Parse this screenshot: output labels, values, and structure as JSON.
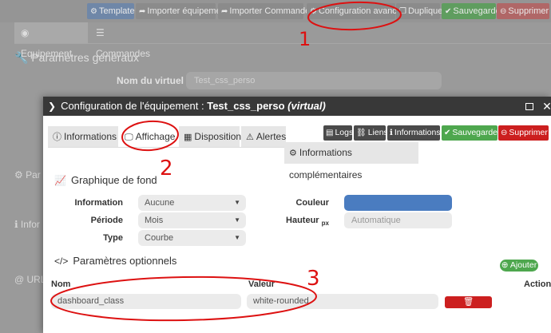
{
  "topbar": {
    "template": "Template",
    "import_equipment": "Importer équipement",
    "import_commands": "Importer Commandes",
    "advanced_config": "Configuration avancée",
    "duplicate": "Dupliquer",
    "save": "Sauvegarder",
    "delete": "Supprimer"
  },
  "bg_tabs": {
    "equipment": "Equipement",
    "commands": "Commandes"
  },
  "bg_page": {
    "general_params": "Paramètres généraux",
    "virtual_name_label": "Nom du virtuel",
    "virtual_name_value": "Test_css_perso",
    "side_partial_1": "Par",
    "side_partial_2": "Infor",
    "side_partial_3": "URL"
  },
  "modal": {
    "title_prefix": "Configuration de l'équipement : ",
    "title_name": "Test_css_perso",
    "title_suffix": "(virtual)",
    "tabs": {
      "informations": "Informations",
      "affichage": "Affichage",
      "disposition": "Disposition",
      "alertes": "Alertes"
    },
    "actions": {
      "logs": "Logs",
      "liens": "Liens",
      "informations": "Informations",
      "save": "Sauvegarder",
      "delete": "Supprimer"
    },
    "infos_comp": "Informations complémentaires",
    "graph_section": "Graphique de fond",
    "fields": {
      "information_label": "Information",
      "information_value": "Aucune",
      "periode_label": "Période",
      "periode_value": "Mois",
      "type_label": "Type",
      "type_value": "Courbe",
      "couleur_label": "Couleur",
      "couleur_value": "#4a7cc0",
      "hauteur_label": "Hauteur",
      "hauteur_unit": "px",
      "hauteur_placeholder": "Automatique"
    },
    "params_section": "Paramètres optionnels",
    "add_button": "Ajouter",
    "table": {
      "col_nom": "Nom",
      "col_valeur": "Valeur",
      "col_action": "Action",
      "rows": [
        {
          "nom": "dashboard_class",
          "valeur": "white-rounded",
          "action": "Supprimer"
        }
      ]
    }
  },
  "annotations": [
    "1",
    "2",
    "3"
  ],
  "colors": {
    "annotation": "#dd1111",
    "save": "#4ea74e",
    "delete": "#cc1f1f",
    "dark": "#383838"
  }
}
